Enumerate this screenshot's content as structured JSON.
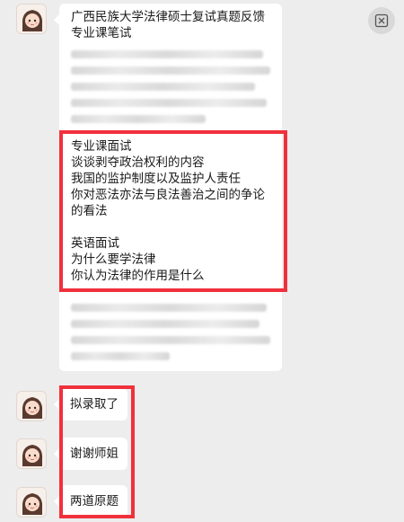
{
  "chat": {
    "messages": [
      {
        "lines": [
          "广西民族大学法律硕士复试真题反馈",
          "专业课笔试"
        ],
        "face": {
          "lines": [
            "专业课面试",
            "谈谈剥夺政治权利的内容",
            "我国的监护制度以及监护人责任",
            "你对恶法亦法与良法善治之间的争论",
            "的看法",
            "",
            "英语面试",
            "为什么要学法律",
            "你认为法律的作用是什么"
          ]
        }
      },
      {
        "text": "拟录取了"
      },
      {
        "text": "谢谢师姐"
      },
      {
        "text": "两道原题"
      }
    ]
  },
  "ui": {
    "close_icon": "close-icon",
    "highlight_color": "#f0313c"
  }
}
